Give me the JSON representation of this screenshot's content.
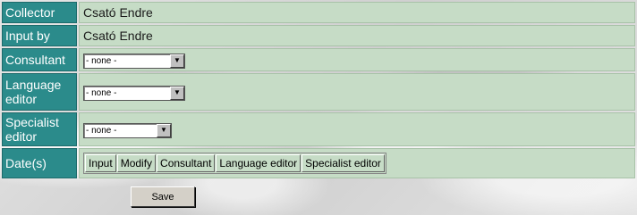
{
  "form": {
    "rows": {
      "collector": {
        "label": "Collector",
        "value": "Csató Endre"
      },
      "input_by": {
        "label": "Input by",
        "value": "Csató Endre"
      },
      "consultant": {
        "label": "Consultant",
        "selected": "- none -"
      },
      "language_editor": {
        "label": "Language editor",
        "selected": "- none -"
      },
      "specialist_editor": {
        "label": "Specialist editor",
        "selected": "- none -"
      },
      "dates": {
        "label": "Date(s)",
        "buttons": [
          "Input",
          "Modify",
          "Consultant",
          "Language editor",
          "Specialist editor"
        ]
      }
    },
    "save_label": "Save"
  },
  "colors": {
    "label_bg": "#2b8b8b",
    "value_bg": "#c6dcc6",
    "label_text": "#ffffff"
  },
  "icons": {
    "dropdown": "chevron-down-icon"
  }
}
